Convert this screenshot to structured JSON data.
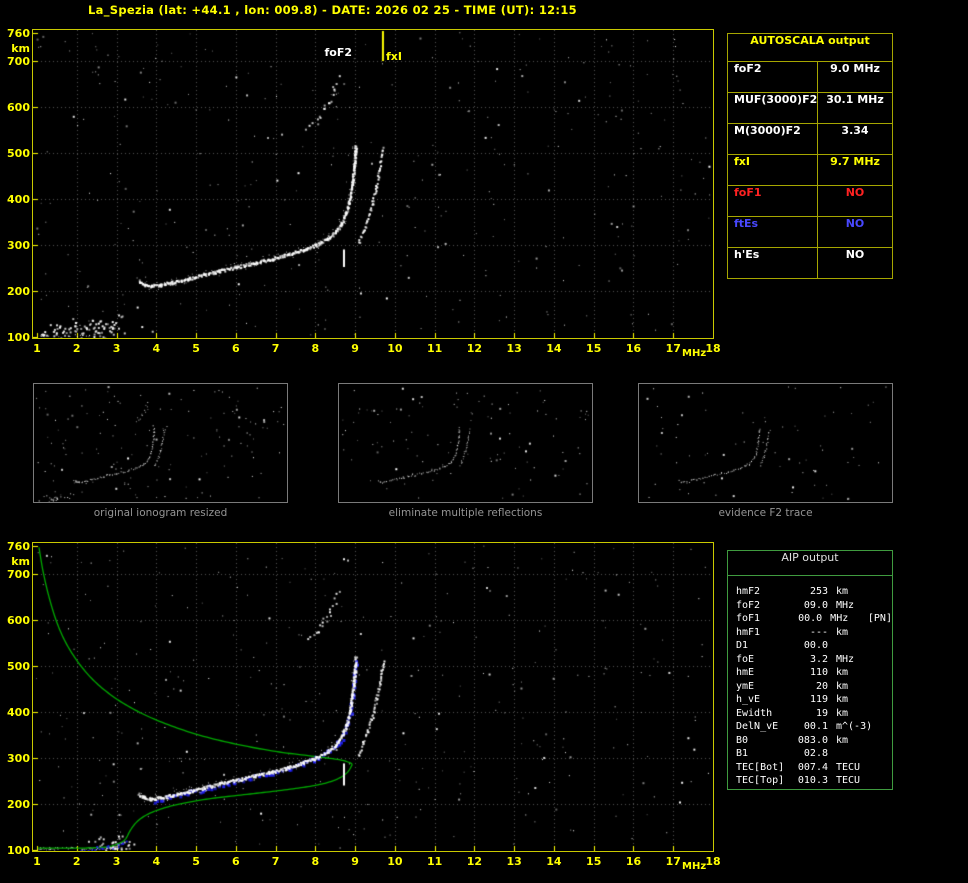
{
  "title": "La_Spezia (lat: +44.1 , lon: 009.8) - DATE: 2026 02 25 - TIME (UT): 12:15",
  "colors": {
    "background": "#000000",
    "axis_yellow": "#ffff00",
    "plot_border": "#c9c900",
    "grid": "#a5a5a5",
    "trace_white": "#ffffff",
    "profile_green": "#00a800",
    "fit_blue": "#2222ff",
    "table_border": "#a6a600",
    "aip_border": "#3f9b3f",
    "caption_grey": "#949494",
    "foF1_red": "#ff2222",
    "ftEs_blue": "#4848ff"
  },
  "autoscala_table": {
    "header": "AUTOSCALA output",
    "rows": [
      {
        "label": "foF2",
        "value": "9.0 MHz",
        "color": "#ffffff"
      },
      {
        "label": "MUF(3000)F2",
        "value": "30.1 MHz",
        "color": "#ffffff"
      },
      {
        "label": "M(3000)F2",
        "value": "3.34",
        "color": "#ffffff"
      },
      {
        "label": "fxI",
        "value": "9.7 MHz",
        "color": "#ffff00"
      },
      {
        "label": "foF1",
        "value": "NO",
        "color": "#ff2222"
      },
      {
        "label": "ftEs",
        "value": "NO",
        "color": "#4848ff"
      },
      {
        "label": "h'Es",
        "value": "NO",
        "color": "#ffffff"
      }
    ]
  },
  "thumbnails": [
    {
      "caption": "original ionogram resized"
    },
    {
      "caption": "eliminate multiple reflections"
    },
    {
      "caption": "evidence F2 trace"
    }
  ],
  "aip_table": {
    "header": "AIP output",
    "rows": [
      {
        "name": "hmF2",
        "value": "253",
        "unit": "km",
        "extra": ""
      },
      {
        "name": "foF2",
        "value": "09.0",
        "unit": "MHz",
        "extra": ""
      },
      {
        "name": "foF1",
        "value": "00.0",
        "unit": "MHz",
        "extra": "[PN]"
      },
      {
        "name": "hmF1",
        "value": "---",
        "unit": "km",
        "extra": ""
      },
      {
        "name": "D1",
        "value": "00.0",
        "unit": "",
        "extra": ""
      },
      {
        "name": "foE",
        "value": "3.2",
        "unit": "MHz",
        "extra": ""
      },
      {
        "name": "hmE",
        "value": "110",
        "unit": "km",
        "extra": ""
      },
      {
        "name": "ymE",
        "value": "20",
        "unit": "km",
        "extra": ""
      },
      {
        "name": "h_vE",
        "value": "119",
        "unit": "km",
        "extra": ""
      },
      {
        "name": "Ewidth",
        "value": "19",
        "unit": "km",
        "extra": ""
      },
      {
        "name": "DelN_vE",
        "value": "00.1",
        "unit": "m^(-3)",
        "extra": ""
      },
      {
        "name": "B0",
        "value": "083.0",
        "unit": "km",
        "extra": ""
      },
      {
        "name": "B1",
        "value": "02.8",
        "unit": "",
        "extra": ""
      },
      {
        "name": "TEC[Bot]",
        "value": "007.4",
        "unit": "TECU",
        "extra": ""
      },
      {
        "name": "TEC[Top]",
        "value": "010.3",
        "unit": "TECU",
        "extra": ""
      }
    ]
  },
  "chart_data": [
    {
      "id": "ionogram_main",
      "type": "scatter",
      "title": "recorded ionogram with Autoscala markers",
      "xlabel": "MHz",
      "ylabel": "km",
      "xlim": [
        1,
        18
      ],
      "ylim": [
        100,
        760
      ],
      "x_ticks": [
        1,
        2,
        3,
        4,
        5,
        6,
        7,
        8,
        9,
        10,
        11,
        12,
        13,
        14,
        15,
        16,
        17,
        18
      ],
      "y_ticks": [
        760,
        700,
        600,
        500,
        400,
        300,
        200,
        100
      ],
      "grid": true,
      "annotations": [
        {
          "label": "foF2",
          "x_mhz": 8.5,
          "color": "#ffffff"
        },
        {
          "label": "fxI",
          "x_mhz": 9.8,
          "color": "#ffff00"
        }
      ],
      "fxI_line_mhz": 9.7,
      "hmF2_marker": {
        "x_mhz": 8.72,
        "km_from": 252,
        "km_to": 290
      },
      "traces": {
        "f2_omode": [
          [
            3.55,
            222
          ],
          [
            3.68,
            215
          ],
          [
            3.85,
            212
          ],
          [
            4.1,
            214
          ],
          [
            4.4,
            220
          ],
          [
            4.8,
            228
          ],
          [
            5.2,
            237
          ],
          [
            5.6,
            245
          ],
          [
            6.0,
            253
          ],
          [
            6.45,
            262
          ],
          [
            6.9,
            271
          ],
          [
            7.3,
            280
          ],
          [
            7.7,
            291
          ],
          [
            8.0,
            301
          ],
          [
            8.3,
            315
          ],
          [
            8.5,
            330
          ],
          [
            8.65,
            348
          ],
          [
            8.77,
            372
          ],
          [
            8.86,
            403
          ],
          [
            8.92,
            438
          ],
          [
            8.96,
            470
          ],
          [
            8.99,
            500
          ],
          [
            9.0,
            518
          ]
        ],
        "f2_xmode": [
          [
            9.06,
            305
          ],
          [
            9.18,
            330
          ],
          [
            9.3,
            358
          ],
          [
            9.42,
            392
          ],
          [
            9.52,
            428
          ],
          [
            9.6,
            462
          ],
          [
            9.66,
            495
          ],
          [
            9.69,
            512
          ]
        ],
        "second_hop": [
          [
            7.75,
            556
          ],
          [
            8.0,
            570
          ],
          [
            8.2,
            592
          ],
          [
            8.35,
            616
          ],
          [
            8.47,
            642
          ],
          [
            8.55,
            663
          ]
        ]
      }
    },
    {
      "id": "ionogram_profile",
      "type": "scatter",
      "title": "ionogram with restored trace and electron density profile",
      "xlabel": "MHz",
      "ylabel": "km",
      "xlim": [
        1,
        18
      ],
      "ylim": [
        100,
        760
      ],
      "x_ticks": [
        1,
        2,
        3,
        4,
        5,
        6,
        7,
        8,
        9,
        10,
        11,
        12,
        13,
        14,
        15,
        16,
        17,
        18
      ],
      "y_ticks": [
        760,
        700,
        600,
        500,
        400,
        300,
        200,
        100
      ],
      "grid": true,
      "hmF2_marker": {
        "x_mhz": 8.72,
        "km_from": 240,
        "km_to": 288
      },
      "traces": {
        "f2_omode": [
          [
            3.55,
            222
          ],
          [
            3.68,
            215
          ],
          [
            3.85,
            212
          ],
          [
            4.1,
            214
          ],
          [
            4.4,
            220
          ],
          [
            4.8,
            228
          ],
          [
            5.2,
            237
          ],
          [
            5.6,
            245
          ],
          [
            6.0,
            253
          ],
          [
            6.45,
            262
          ],
          [
            6.9,
            271
          ],
          [
            7.3,
            280
          ],
          [
            7.7,
            291
          ],
          [
            8.0,
            301
          ],
          [
            8.3,
            315
          ],
          [
            8.5,
            330
          ],
          [
            8.65,
            348
          ],
          [
            8.77,
            372
          ],
          [
            8.86,
            403
          ],
          [
            8.92,
            438
          ],
          [
            8.96,
            470
          ],
          [
            8.99,
            500
          ],
          [
            9.0,
            518
          ]
        ],
        "f2_xmode": [
          [
            9.06,
            305
          ],
          [
            9.18,
            330
          ],
          [
            9.3,
            358
          ],
          [
            9.42,
            392
          ],
          [
            9.52,
            428
          ],
          [
            9.6,
            462
          ],
          [
            9.66,
            495
          ],
          [
            9.69,
            512
          ]
        ],
        "second_hop": [
          [
            7.75,
            556
          ],
          [
            8.0,
            570
          ],
          [
            8.2,
            592
          ],
          [
            8.35,
            616
          ],
          [
            8.47,
            642
          ],
          [
            8.55,
            663
          ]
        ],
        "fit": [
          [
            3.9,
            210
          ],
          [
            4.3,
            217
          ],
          [
            4.8,
            227
          ],
          [
            5.3,
            237
          ],
          [
            5.8,
            247
          ],
          [
            6.3,
            257
          ],
          [
            6.8,
            268
          ],
          [
            7.3,
            279
          ],
          [
            7.7,
            290
          ],
          [
            8.05,
            302
          ],
          [
            8.35,
            317
          ],
          [
            8.55,
            333
          ],
          [
            8.7,
            352
          ],
          [
            8.8,
            378
          ],
          [
            8.88,
            410
          ],
          [
            8.93,
            445
          ],
          [
            8.97,
            478
          ],
          [
            9.0,
            508
          ]
        ],
        "fit_e": [
          [
            2.1,
            103
          ],
          [
            2.5,
            105
          ],
          [
            2.8,
            107
          ],
          [
            3.0,
            110
          ],
          [
            3.15,
            115
          ],
          [
            3.22,
            120
          ]
        ],
        "profile": {
          "topside": [
            [
              1.05,
              757
            ],
            [
              1.15,
              706
            ],
            [
              1.3,
              650
            ],
            [
              1.5,
              594
            ],
            [
              1.75,
              546
            ],
            [
              2.1,
              500
            ],
            [
              2.5,
              462
            ],
            [
              3.0,
              428
            ],
            [
              3.6,
              398
            ],
            [
              4.3,
              372
            ],
            [
              5.1,
              349
            ],
            [
              6.0,
              330
            ],
            [
              7.0,
              314
            ],
            [
              7.9,
              304
            ],
            [
              8.6,
              296
            ],
            [
              8.85,
              290
            ],
            [
              8.93,
              286
            ]
          ],
          "bottomside": [
            [
              8.93,
              286
            ],
            [
              8.8,
              268
            ],
            [
              8.55,
              254
            ],
            [
              8.2,
              244
            ],
            [
              7.7,
              236
            ],
            [
              7.0,
              228
            ],
            [
              6.2,
              220
            ],
            [
              5.4,
              212
            ],
            [
              4.7,
              202
            ],
            [
              4.15,
              190
            ],
            [
              3.75,
              176
            ],
            [
              3.5,
              160
            ],
            [
              3.35,
              143
            ],
            [
              3.27,
              130
            ],
            [
              3.23,
              124
            ]
          ],
          "e_layer": [
            [
              3.23,
              124
            ],
            [
              3.15,
              118
            ],
            [
              3.0,
              112
            ],
            [
              2.8,
              107
            ],
            [
              2.5,
              105
            ],
            [
              2.0,
              104
            ],
            [
              1.5,
              104
            ],
            [
              1.02,
              104
            ]
          ]
        }
      }
    }
  ]
}
